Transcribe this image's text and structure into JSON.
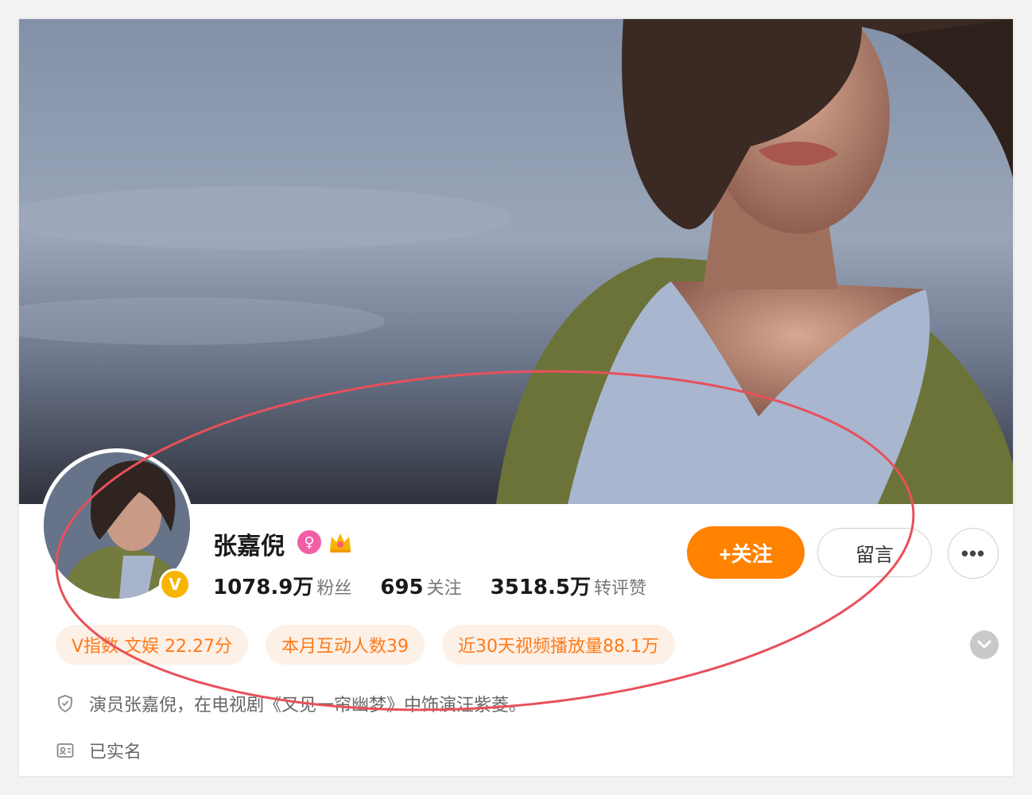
{
  "profile": {
    "name": "张嘉倪",
    "verified_badge": "V",
    "gender_icon": "female-icon",
    "crown_icon": "crown-icon"
  },
  "stats": [
    {
      "value": "1078.9万",
      "label": "粉丝"
    },
    {
      "value": "695",
      "label": "关注"
    },
    {
      "value": "3518.5万",
      "label": "转评赞"
    }
  ],
  "actions": {
    "follow_label": "+关注",
    "message_label": "留言",
    "more_label": "•••"
  },
  "tags": [
    "V指数 文娱 22.27分",
    "本月互动人数39",
    "近30天视频播放量88.1万"
  ],
  "info": {
    "bio": "演员张嘉倪，在电视剧《又见一帘幽梦》中饰演汪紫菱。",
    "verification": "已实名"
  },
  "colors": {
    "accent": "#ff8200",
    "tag_text": "#ff7a1a",
    "tag_bg": "#fdf0e6",
    "annotation": "#e8505b"
  }
}
